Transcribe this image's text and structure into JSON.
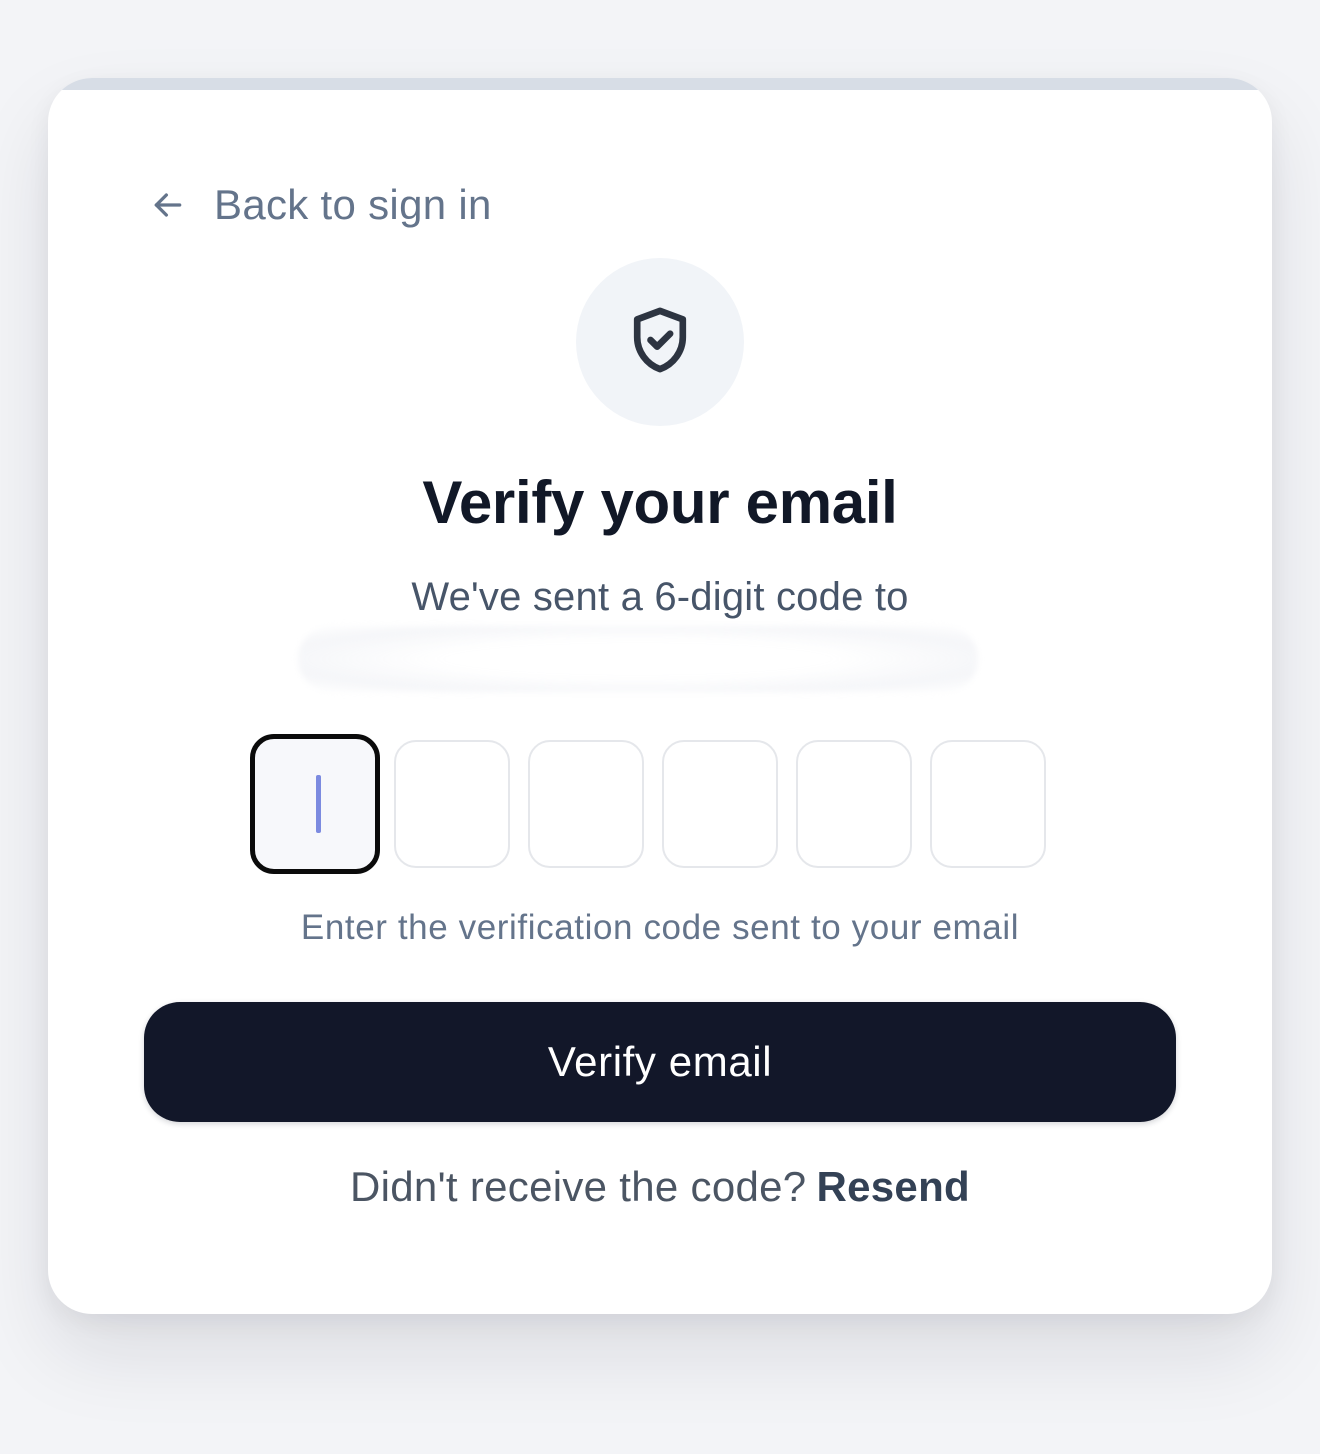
{
  "back_link": {
    "label": "Back to sign in",
    "icon": "arrow-left-icon"
  },
  "badge": {
    "icon": "shield-check-icon"
  },
  "title": "Verify your email",
  "subtitle": "We've sent a 6-digit code to",
  "code_input": {
    "length": 6,
    "values": [
      "",
      "",
      "",
      "",
      "",
      ""
    ],
    "active_index": 0
  },
  "helper_text": "Enter the verification code sent to your email",
  "primary_button": {
    "label": "Verify email"
  },
  "resend": {
    "prompt": "Didn't receive the code?",
    "link_label": "Resend"
  },
  "colors": {
    "page_bg": "#f3f4f7",
    "card_bg": "#ffffff",
    "primary": "#121729",
    "muted_text": "#64748b",
    "caret": "#7c8be0"
  }
}
